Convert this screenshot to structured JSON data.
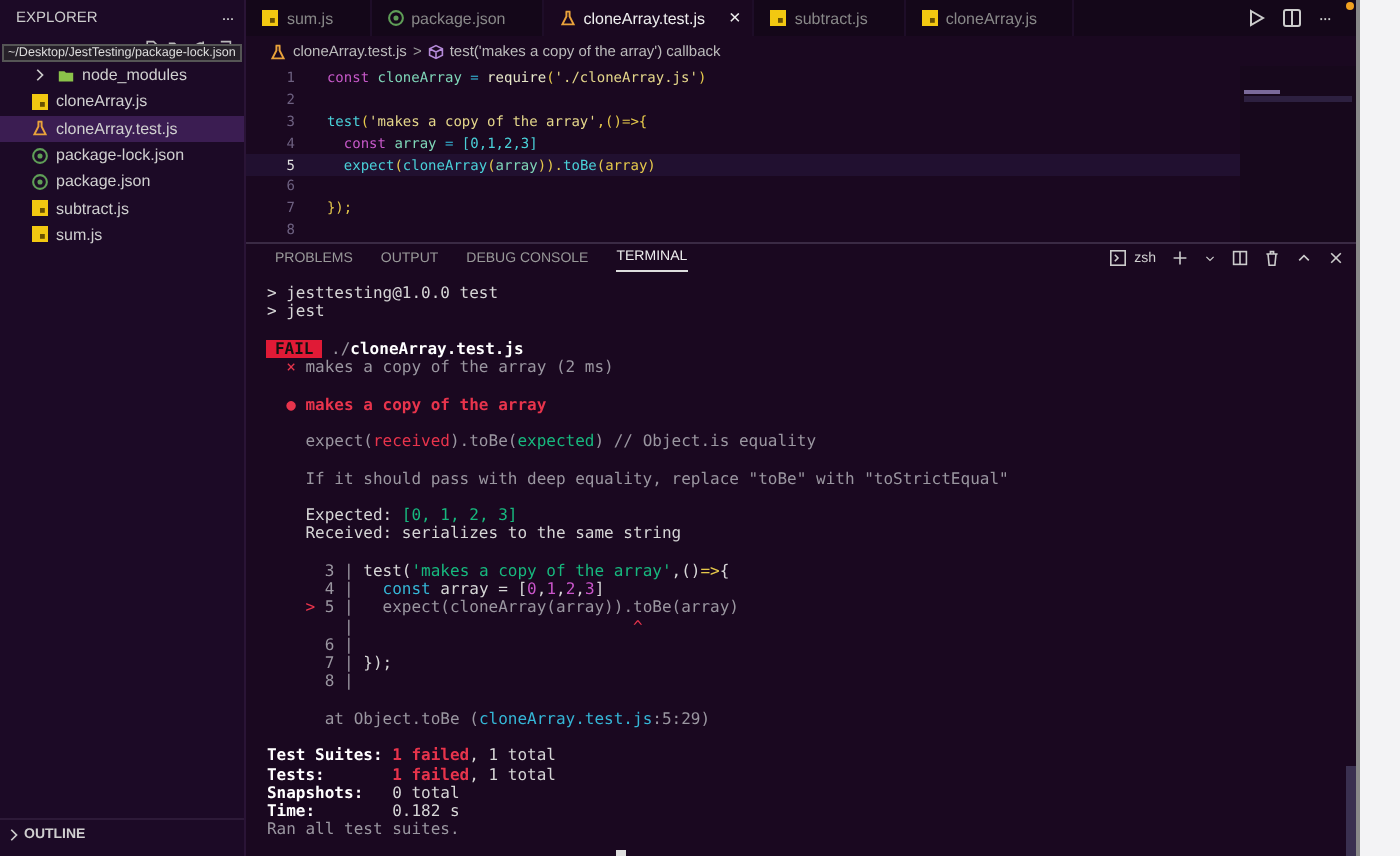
{
  "sidebar": {
    "title": "EXPLORER",
    "more": "···",
    "tooltip": "~/Desktop/JestTesting/package-lock.json",
    "items": [
      {
        "label": "node_modules",
        "kind": "folder",
        "selected": false
      },
      {
        "label": "cloneArray.js",
        "kind": "js",
        "selected": false
      },
      {
        "label": "cloneArray.test.js",
        "kind": "test",
        "selected": true
      },
      {
        "label": "package-lock.json",
        "kind": "json",
        "selected": false
      },
      {
        "label": "package.json",
        "kind": "json",
        "selected": false
      },
      {
        "label": "subtract.js",
        "kind": "js",
        "selected": false
      },
      {
        "label": "sum.js",
        "kind": "js",
        "selected": false
      }
    ],
    "sections": [
      "OUTLINE"
    ]
  },
  "tabs": [
    {
      "label": "sum.js",
      "kind": "js",
      "selected": false
    },
    {
      "label": "package.json",
      "kind": "json",
      "selected": false
    },
    {
      "label": "cloneArray.test.js",
      "kind": "test",
      "selected": true,
      "close": "×"
    },
    {
      "label": "subtract.js",
      "kind": "js",
      "selected": false
    },
    {
      "label": "cloneArray.js",
      "kind": "js",
      "selected": false
    }
  ],
  "editor_more": "···",
  "breadcrumb": {
    "file": "cloneArray.test.js",
    "separator": ">",
    "symbol": "test('makes a copy of the array') callback"
  },
  "code": [
    {
      "number": "1",
      "current": false,
      "tokens": [
        {
          "text": "const",
          "kind": "keyword"
        },
        {
          "text": " cloneArray ",
          "kind": "variable"
        },
        {
          "text": "=",
          "kind": "operator"
        },
        {
          "text": " require",
          "kind": "function"
        },
        {
          "text": "(",
          "kind": "bracket"
        },
        {
          "text": "'./cloneArray.js'",
          "kind": "string"
        },
        {
          "text": ")",
          "kind": "bracket"
        }
      ]
    },
    {
      "number": "2",
      "current": false
    },
    {
      "number": "3",
      "current": false,
      "tokens": [
        {
          "text": "test",
          "kind": "call"
        },
        {
          "text": "(",
          "kind": "bracket"
        },
        {
          "text": "'makes a copy of the array'",
          "kind": "string"
        },
        {
          "text": ",()=>{",
          "kind": "bracket"
        }
      ]
    },
    {
      "number": "4",
      "current": false,
      "tokens": [
        {
          "text": "  const",
          "kind": "keyword"
        },
        {
          "text": " array ",
          "kind": "variable"
        },
        {
          "text": "=",
          "kind": "operator"
        },
        {
          "text": " [0,1,2,3]",
          "kind": "call"
        }
      ]
    },
    {
      "number": "5",
      "current": true,
      "tokens": [
        {
          "text": "  expect",
          "kind": "call"
        },
        {
          "text": "(",
          "kind": "bracket"
        },
        {
          "text": "cloneArray",
          "kind": "call"
        },
        {
          "text": "(",
          "kind": "bracket"
        },
        {
          "text": "array",
          "kind": "variable"
        },
        {
          "text": ")).",
          "kind": "bracket"
        },
        {
          "text": "toBe",
          "kind": "call"
        },
        {
          "text": "(array)",
          "kind": "bracket"
        }
      ]
    },
    {
      "number": "6",
      "current": false
    },
    {
      "number": "7",
      "current": false,
      "tokens": [
        {
          "text": "});",
          "kind": "bracket"
        }
      ]
    },
    {
      "number": "8",
      "current": false
    }
  ],
  "panel_tabs": [
    {
      "label": "PROBLEMS",
      "selected": false
    },
    {
      "label": "OUTPUT",
      "selected": false
    },
    {
      "label": "DEBUG CONSOLE",
      "selected": false
    },
    {
      "label": "TERMINAL",
      "selected": true
    }
  ],
  "shell": "zsh",
  "terminal": [
    [
      {
        "segments": [
          {
            "text": "> jesttesting@1.0.0 test",
            "kind": "plain"
          }
        ]
      },
      {
        "segments": [
          {
            "text": "> jest",
            "kind": "plain"
          }
        ]
      }
    ],
    [
      {
        "badge": "FAIL",
        "segments": [
          {
            "text": "./",
            "kind": "dim"
          },
          {
            "text": "cloneArray.test.js",
            "kind": "bold"
          }
        ]
      },
      {
        "segments": [
          {
            "text": "  ×",
            "kind": "red"
          },
          {
            "text": " makes a copy of the array (2 ms)",
            "kind": "dim"
          }
        ]
      }
    ],
    [
      {
        "segments": [
          {
            "text": "  ● makes a copy of the array",
            "kind": "redbold"
          }
        ]
      }
    ],
    [
      {
        "segments": [
          {
            "text": "    expect(",
            "kind": "dim"
          },
          {
            "text": "received",
            "kind": "red"
          },
          {
            "text": ").toBe(",
            "kind": "dim"
          },
          {
            "text": "expected",
            "kind": "green"
          },
          {
            "text": ") // Object.is equality",
            "kind": "dim"
          }
        ]
      }
    ],
    [
      {
        "segments": [
          {
            "text": "    If it should pass with deep equality, replace \"toBe\" with \"toStrictEqual\"",
            "kind": "dim"
          }
        ]
      }
    ],
    [
      {
        "segments": [
          {
            "text": "    Expected: ",
            "kind": "plain"
          },
          {
            "text": "[0, 1, 2, 3]",
            "kind": "green"
          }
        ]
      },
      {
        "segments": [
          {
            "text": "    Received: serializes to the same string",
            "kind": "plain"
          }
        ]
      }
    ],
    [
      {
        "segments": [
          {
            "text": "      3 | ",
            "kind": "dim"
          },
          {
            "text": "test(",
            "kind": "plain"
          },
          {
            "text": "'makes a copy of the array'",
            "kind": "green"
          },
          {
            "text": ",()",
            "kind": "plain"
          },
          {
            "text": "=>",
            "kind": "yellow"
          },
          {
            "text": "{",
            "kind": "plain"
          }
        ]
      },
      {
        "segments": [
          {
            "text": "      4 |   ",
            "kind": "dim"
          },
          {
            "text": "const",
            "kind": "cyan"
          },
          {
            "text": " array = [",
            "kind": "plain"
          },
          {
            "text": "0",
            "kind": "magenta"
          },
          {
            "text": ",",
            "kind": "plain"
          },
          {
            "text": "1",
            "kind": "magenta"
          },
          {
            "text": ",",
            "kind": "plain"
          },
          {
            "text": "2",
            "kind": "magenta"
          },
          {
            "text": ",",
            "kind": "plain"
          },
          {
            "text": "3",
            "kind": "magenta"
          },
          {
            "text": "]",
            "kind": "plain"
          }
        ]
      },
      {
        "segments": [
          {
            "text": "    >",
            "kind": "red"
          },
          {
            "text": " 5 |   expect(cloneArray(array)).toBe(array)",
            "kind": "dim"
          }
        ]
      },
      {
        "segments": [
          {
            "text": "        |                             ",
            "kind": "dim"
          },
          {
            "text": "^",
            "kind": "red"
          }
        ]
      },
      {
        "segments": [
          {
            "text": "      6 |",
            "kind": "dim"
          }
        ]
      },
      {
        "segments": [
          {
            "text": "      7 | ",
            "kind": "dim"
          },
          {
            "text": "});",
            "kind": "plain"
          }
        ]
      },
      {
        "segments": [
          {
            "text": "      8 |",
            "kind": "dim"
          }
        ]
      }
    ],
    [
      {
        "segments": [
          {
            "text": "      at Object.toBe (",
            "kind": "dim"
          },
          {
            "text": "cloneArray.test.js",
            "kind": "cyan"
          },
          {
            "text": ":5:29)",
            "kind": "dim"
          }
        ]
      }
    ],
    [
      {
        "segments": [
          {
            "text": "Test Suites: ",
            "kind": "bold"
          },
          {
            "text": "1 failed",
            "kind": "redbold"
          },
          {
            "text": ", 1 total",
            "kind": "plain"
          }
        ]
      },
      {
        "segments": [
          {
            "text": "Tests:       ",
            "kind": "bold"
          },
          {
            "text": "1 failed",
            "kind": "redbold"
          },
          {
            "text": ", 1 total",
            "kind": "plain"
          }
        ]
      },
      {
        "segments": [
          {
            "text": "Snapshots:   ",
            "kind": "bold"
          },
          {
            "text": "0 total",
            "kind": "plain"
          }
        ]
      },
      {
        "segments": [
          {
            "text": "Time:        ",
            "kind": "bold"
          },
          {
            "text": "0.182 s",
            "kind": "plain"
          }
        ]
      },
      {
        "segments": [
          {
            "text": "Ran all test suites.",
            "kind": "dim"
          }
        ]
      }
    ]
  ]
}
